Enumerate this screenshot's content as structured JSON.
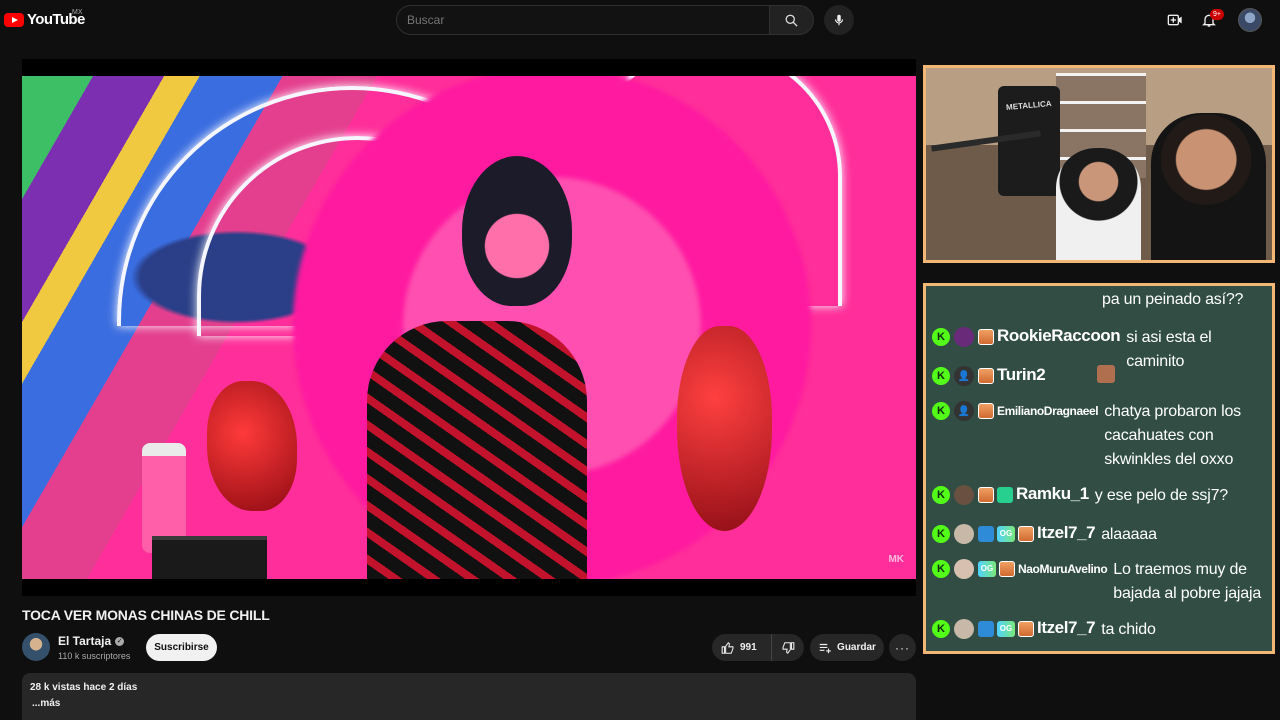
{
  "header": {
    "logo_text": "YouTube",
    "country_code": "MX",
    "search_placeholder": "Buscar",
    "notifications_count": "9+",
    "icons": {
      "search": "search-icon",
      "mic": "mic-icon",
      "create": "create-icon",
      "notifications": "bell-icon"
    }
  },
  "player": {
    "watermark": "MK"
  },
  "video": {
    "title": "TOCA VER MONAS CHINAS DE CHILL",
    "channel_name": "El Tartaja",
    "subscribers": "110 k suscriptores",
    "subscribe_label": "Suscribirse",
    "likes": "991",
    "save_label": "Guardar",
    "more_label": "···",
    "views_date": "28 k vistas  hace 2 días",
    "more_text": "...más"
  },
  "stream_overlay": {
    "poster_text": "METALLICA",
    "chat": [
      {
        "user": "",
        "message": "pa un peinado así??"
      },
      {
        "user": "RookieRaccoon",
        "message": "si asi esta el caminito"
      },
      {
        "user": "Turin2",
        "message": ""
      },
      {
        "user": "EmilianoDragnaeel",
        "message": "chatya probaron los cacahuates con skwinkles del oxxo"
      },
      {
        "user": "Ramku_1",
        "message": "y ese pelo de ssj7?"
      },
      {
        "user": "Itzel7_7",
        "message": "alaaaaa"
      },
      {
        "user": "NaoMuruAvelino",
        "message": "Lo traemos muy de bajada al pobre jajaja"
      },
      {
        "user": "Itzel7_7",
        "message": "ta chido"
      }
    ]
  },
  "colors": {
    "brand_red": "#ff0000",
    "overlay_border": "#f2b774",
    "chat_bg": "#35544a",
    "kick_green": "#53fc18"
  }
}
